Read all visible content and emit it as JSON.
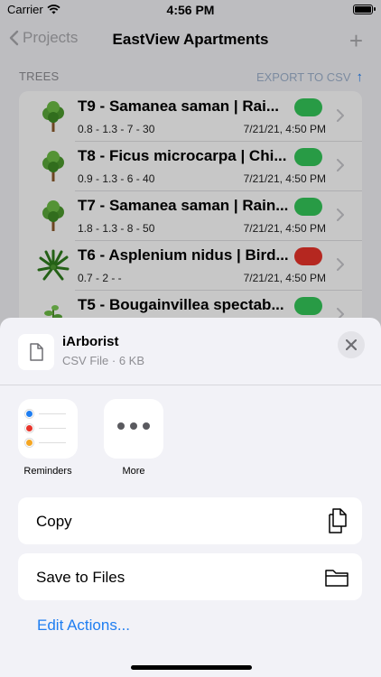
{
  "status_bar": {
    "carrier": "Carrier",
    "time": "4:56 PM"
  },
  "nav": {
    "back_label": "Projects",
    "title": "EastView Apartments",
    "add_icon": "plus-icon"
  },
  "section": {
    "label": "TREES",
    "export_label": "EXPORT TO CSV",
    "export_icon": "arrow-up-icon"
  },
  "trees": [
    {
      "title": "T9 - Samanea saman | Rai...",
      "meta": "0.8 - 1.3 - 7 - 30",
      "date": "7/21/21, 4:50 PM",
      "status_color": "#34c759",
      "icon": "tree-icon"
    },
    {
      "title": "T8 - Ficus microcarpa | Chi...",
      "meta": "0.9 - 1.3 - 6 - 40",
      "date": "7/21/21, 4:50 PM",
      "status_color": "#34c759",
      "icon": "tree-icon"
    },
    {
      "title": "T7 - Samanea saman | Rain...",
      "meta": "1.8 - 1.3 - 8 - 50",
      "date": "7/21/21, 4:50 PM",
      "status_color": "#34c759",
      "icon": "tree-icon"
    },
    {
      "title": "T6 - Asplenium nidus | Bird...",
      "meta": "0.7 - 2 -  -",
      "date": "7/21/21, 4:50 PM",
      "status_color": "#e8332a",
      "icon": "fern-icon"
    },
    {
      "title": "T5 - Bougainvillea spectab...",
      "meta": "",
      "date": "",
      "status_color": "#34c759",
      "icon": "vine-icon"
    }
  ],
  "share_sheet": {
    "file_name": "iArborist",
    "file_info": "CSV File · 6 KB",
    "apps": [
      {
        "label": "Reminders",
        "icon": "reminders-icon"
      },
      {
        "label": "More",
        "icon": "more-icon"
      }
    ],
    "actions": [
      {
        "label": "Copy",
        "icon": "copy-icon"
      },
      {
        "label": "Save to Files",
        "icon": "folder-icon"
      }
    ],
    "edit_actions": "Edit Actions..."
  },
  "colors": {
    "accent": "#1f7ef1",
    "green": "#34c759",
    "red": "#e8332a"
  }
}
